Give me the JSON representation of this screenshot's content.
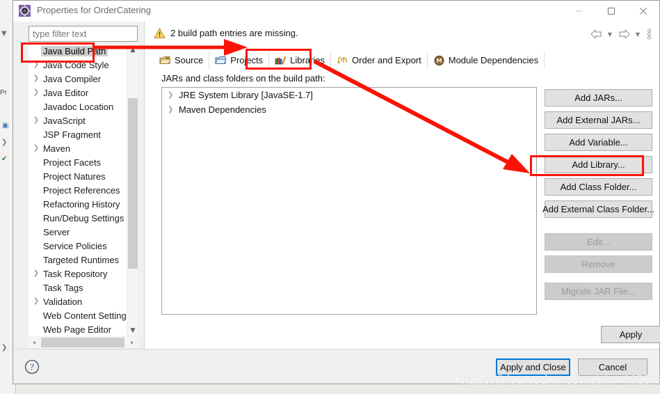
{
  "window": {
    "title": "Properties for OrderCatering",
    "icon": "eclipse-properties-icon",
    "minimize_label": "Minimize",
    "maximize_label": "Maximize",
    "close_label": "Close"
  },
  "colors": {
    "annotation_red": "#fa1305",
    "focus_blue": "#0078d7",
    "dialog_bg": "#f0f0f0",
    "selection_gray": "#cecece",
    "warning_amber": "#f0b323"
  },
  "filter": {
    "placeholder": "type filter text",
    "value": ""
  },
  "tree": {
    "items": [
      {
        "label": "Java Build Path",
        "expandable": false,
        "selected": true
      },
      {
        "label": "Java Code Style",
        "expandable": true,
        "selected": false
      },
      {
        "label": "Java Compiler",
        "expandable": true,
        "selected": false
      },
      {
        "label": "Java Editor",
        "expandable": true,
        "selected": false
      },
      {
        "label": "Javadoc Location",
        "expandable": false,
        "selected": false
      },
      {
        "label": "JavaScript",
        "expandable": true,
        "selected": false
      },
      {
        "label": "JSP Fragment",
        "expandable": false,
        "selected": false
      },
      {
        "label": "Maven",
        "expandable": true,
        "selected": false
      },
      {
        "label": "Project Facets",
        "expandable": false,
        "selected": false
      },
      {
        "label": "Project Natures",
        "expandable": false,
        "selected": false
      },
      {
        "label": "Project References",
        "expandable": false,
        "selected": false
      },
      {
        "label": "Refactoring History",
        "expandable": false,
        "selected": false
      },
      {
        "label": "Run/Debug Settings",
        "expandable": false,
        "selected": false
      },
      {
        "label": "Server",
        "expandable": false,
        "selected": false
      },
      {
        "label": "Service Policies",
        "expandable": false,
        "selected": false
      },
      {
        "label": "Targeted Runtimes",
        "expandable": false,
        "selected": false
      },
      {
        "label": "Task Repository",
        "expandable": true,
        "selected": false
      },
      {
        "label": "Task Tags",
        "expandable": false,
        "selected": false
      },
      {
        "label": "Validation",
        "expandable": true,
        "selected": false
      },
      {
        "label": "Web Content Settings",
        "expandable": false,
        "selected": false
      },
      {
        "label": "Web Page Editor",
        "expandable": false,
        "selected": false
      }
    ]
  },
  "message": {
    "icon": "warning-icon",
    "text": "2 build path entries are missing."
  },
  "nav": {
    "back": "back-arrow",
    "back_menu": "back-dropdown",
    "forward": "forward-arrow",
    "forward_menu": "forward-dropdown",
    "overflow": "view-menu"
  },
  "tabs": [
    {
      "label": "Source",
      "icon": "source-folder-icon",
      "active": false
    },
    {
      "label": "Projects",
      "icon": "projects-folder-icon",
      "active": false
    },
    {
      "label": "Libraries",
      "icon": "libraries-books-icon",
      "active": true
    },
    {
      "label": "Order and Export",
      "icon": "order-export-icon",
      "active": false
    },
    {
      "label": "Module Dependencies",
      "icon": "module-icon",
      "active": false
    }
  ],
  "main": {
    "subtitle": "JARs and class folders on the build path:"
  },
  "library_list": [
    {
      "label": "JRE System Library [JavaSE-1.7]",
      "icon": "library-icon",
      "expandable": true
    },
    {
      "label": "Maven Dependencies",
      "icon": "library-icon",
      "expandable": true
    }
  ],
  "action_buttons": [
    {
      "label": "Add JARs...",
      "enabled": true,
      "highlighted": false
    },
    {
      "label": "Add External JARs...",
      "enabled": true,
      "highlighted": false
    },
    {
      "label": "Add Variable...",
      "enabled": true,
      "highlighted": false
    },
    {
      "label": "Add Library...",
      "enabled": true,
      "highlighted": true
    },
    {
      "label": "Add Class Folder...",
      "enabled": true,
      "highlighted": false
    },
    {
      "label": "Add External Class Folder...",
      "enabled": true,
      "highlighted": false
    },
    {
      "label": "Edit...",
      "enabled": false,
      "highlighted": false
    },
    {
      "label": "Remove",
      "enabled": false,
      "highlighted": false
    },
    {
      "label": "Migrate JAR File...",
      "enabled": false,
      "highlighted": false
    }
  ],
  "apply": {
    "label": "Apply"
  },
  "footer": {
    "help": "help-icon",
    "apply_and_close": "Apply and Close",
    "cancel": "Cancel"
  },
  "annotations": {
    "watermark": "https://blog.csdn.net/weixin_44397902",
    "highlight_targets": [
      "Java Build Path",
      "Libraries",
      "Add Library..."
    ],
    "arrow_count": 2
  }
}
